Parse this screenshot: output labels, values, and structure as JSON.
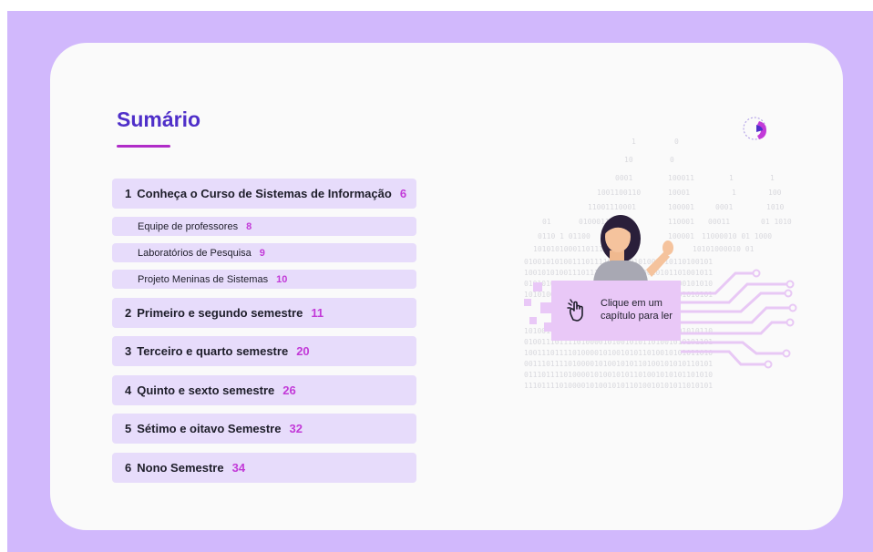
{
  "summary": {
    "title": "Sumário"
  },
  "toc": {
    "items": [
      {
        "num": "1",
        "label": "Conheça o Curso de Sistemas de Informação",
        "page": "6"
      },
      {
        "label": "Equipe de professores",
        "page": "8"
      },
      {
        "label": "Laboratórios de Pesquisa",
        "page": "9"
      },
      {
        "label": "Projeto Meninas de Sistemas",
        "page": "10"
      },
      {
        "num": "2",
        "label": "Primeiro e segundo semestre",
        "page": "11"
      },
      {
        "num": "3",
        "label": "Terceiro e quarto semestre",
        "page": "20"
      },
      {
        "num": "4",
        "label": "Quinto e sexto semestre",
        "page": "26"
      },
      {
        "num": "5",
        "label": "Sétimo e oitavo Semestre",
        "page": "32"
      },
      {
        "num": "6",
        "label": "Nono Semestre",
        "page": "34"
      }
    ]
  },
  "cta": {
    "text": "Clique em um capítulo para ler",
    "icon": "tap-hand-icon"
  },
  "logo": {
    "icon": "profile-logo-icon"
  },
  "colors": {
    "background": "#d1b8fc",
    "card": "#fafafa",
    "title": "#4f2fc9",
    "accent": "#c23ad8",
    "item_bg": "#e7dcfb"
  }
}
